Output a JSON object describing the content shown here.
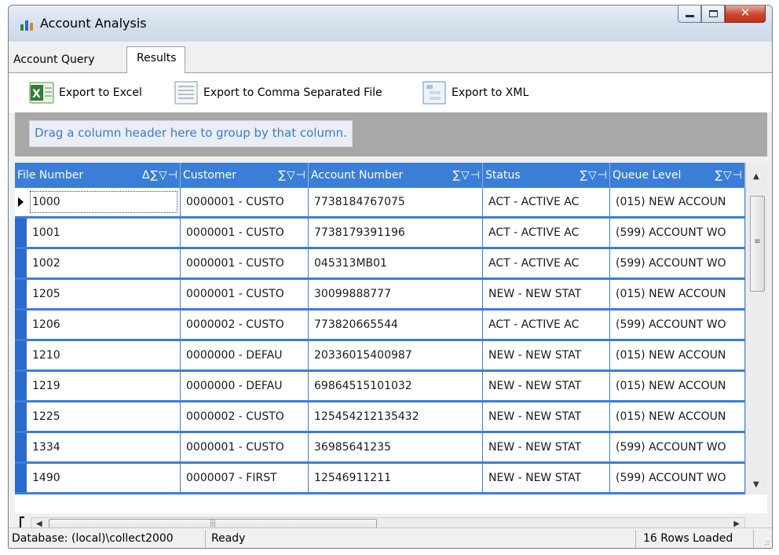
{
  "window": {
    "title": "Account Analysis"
  },
  "tabs": [
    {
      "label": "Account Query",
      "active": false
    },
    {
      "label": "Results",
      "active": true
    }
  ],
  "toolbar": {
    "export_excel": "Export to Excel",
    "export_csv": "Export to Comma Separated File",
    "export_xml": "Export to XML",
    "icons": [
      "excel-icon",
      "csv-file-icon",
      "xml-file-icon"
    ]
  },
  "grid": {
    "group_hint": "Drag a column header here to group by that column.",
    "columns": [
      {
        "label": "File Number",
        "tools": "Δ∑▽⊣"
      },
      {
        "label": "Customer",
        "tools": "∑▽⊣"
      },
      {
        "label": "Account Number",
        "tools": "∑▽⊣"
      },
      {
        "label": "Status",
        "tools": "∑▽⊣"
      },
      {
        "label": "Queue Level",
        "tools": "∑▽⊣"
      }
    ],
    "rows": [
      [
        "1000",
        "0000001 - CUSTO",
        "7738184767075",
        "ACT - ACTIVE AC",
        "(015) NEW ACCOUN"
      ],
      [
        "1001",
        "0000001 - CUSTO",
        "7738179391196",
        "ACT - ACTIVE AC",
        "(599) ACCOUNT WO"
      ],
      [
        "1002",
        "0000001 - CUSTO",
        "045313MB01",
        "ACT - ACTIVE AC",
        "(599) ACCOUNT WO"
      ],
      [
        "1205",
        "0000001 - CUSTO",
        "30099888777",
        "NEW - NEW STAT",
        "(015) NEW ACCOUN"
      ],
      [
        "1206",
        "0000002 - CUSTO",
        "773820665544",
        "ACT - ACTIVE AC",
        "(599) ACCOUNT WO"
      ],
      [
        "1210",
        "0000000 - DEFAU",
        "20336015400987",
        "NEW - NEW STAT",
        "(015) NEW ACCOUN"
      ],
      [
        "1219",
        "0000000 - DEFAU",
        "69864515101032",
        "NEW - NEW STAT",
        "(015) NEW ACCOUN"
      ],
      [
        "1225",
        "0000002 - CUSTO",
        "125454212135432",
        "NEW - NEW STAT",
        "(015) NEW ACCOUN"
      ],
      [
        "1334",
        "0000001 - CUSTO",
        "36985641235",
        "NEW - NEW STAT",
        "(599) ACCOUNT WO"
      ],
      [
        "1490",
        "0000007 - FIRST",
        "12546911211",
        "NEW - NEW STAT",
        "(599) ACCOUNT WO"
      ]
    ]
  },
  "status": {
    "database": "Database: (local)\\collect2000",
    "state": "Ready",
    "rows_loaded": "16 Rows Loaded"
  },
  "colors": {
    "accent": "#3a7ed8",
    "group_hint_text": "#3a7bd5",
    "close_button": "#c9462c"
  }
}
